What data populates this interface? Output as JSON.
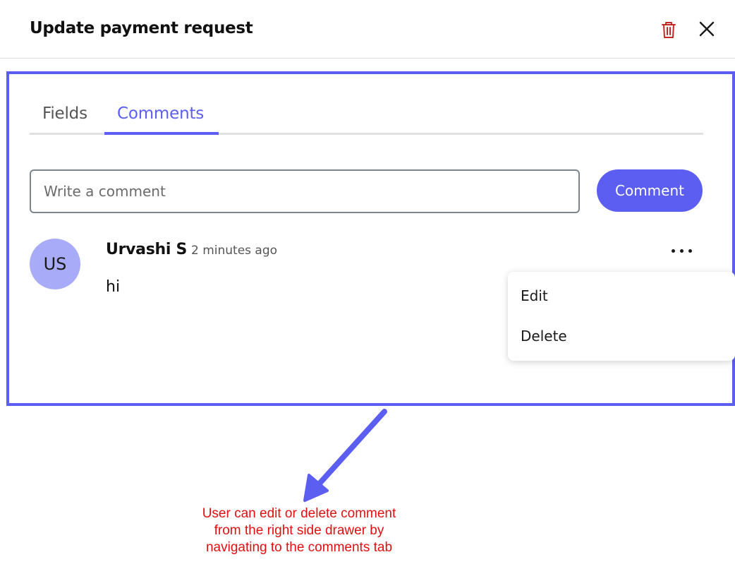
{
  "header": {
    "title": "Update payment request",
    "delete_icon": "trash-icon",
    "close_icon": "close-icon"
  },
  "tabs": [
    {
      "label": "Fields",
      "active": false
    },
    {
      "label": "Comments",
      "active": true
    }
  ],
  "comment_form": {
    "placeholder": "Write a comment",
    "value": "",
    "button_label": "Comment"
  },
  "comments": [
    {
      "avatar_initials": "US",
      "author": "Urvashi S",
      "time": "2 minutes ago",
      "text": "hi"
    }
  ],
  "context_menu": {
    "items": [
      {
        "label": "Edit"
      },
      {
        "label": "Delete"
      }
    ]
  },
  "annotation": {
    "lines": [
      "User can edit or delete comment",
      "from the right side drawer by",
      "navigating to the comments tab"
    ]
  },
  "colors": {
    "accent": "#5b5ef0",
    "avatar_bg": "#a8abf7",
    "danger": "#c62828",
    "annotation_text": "#e01010"
  }
}
